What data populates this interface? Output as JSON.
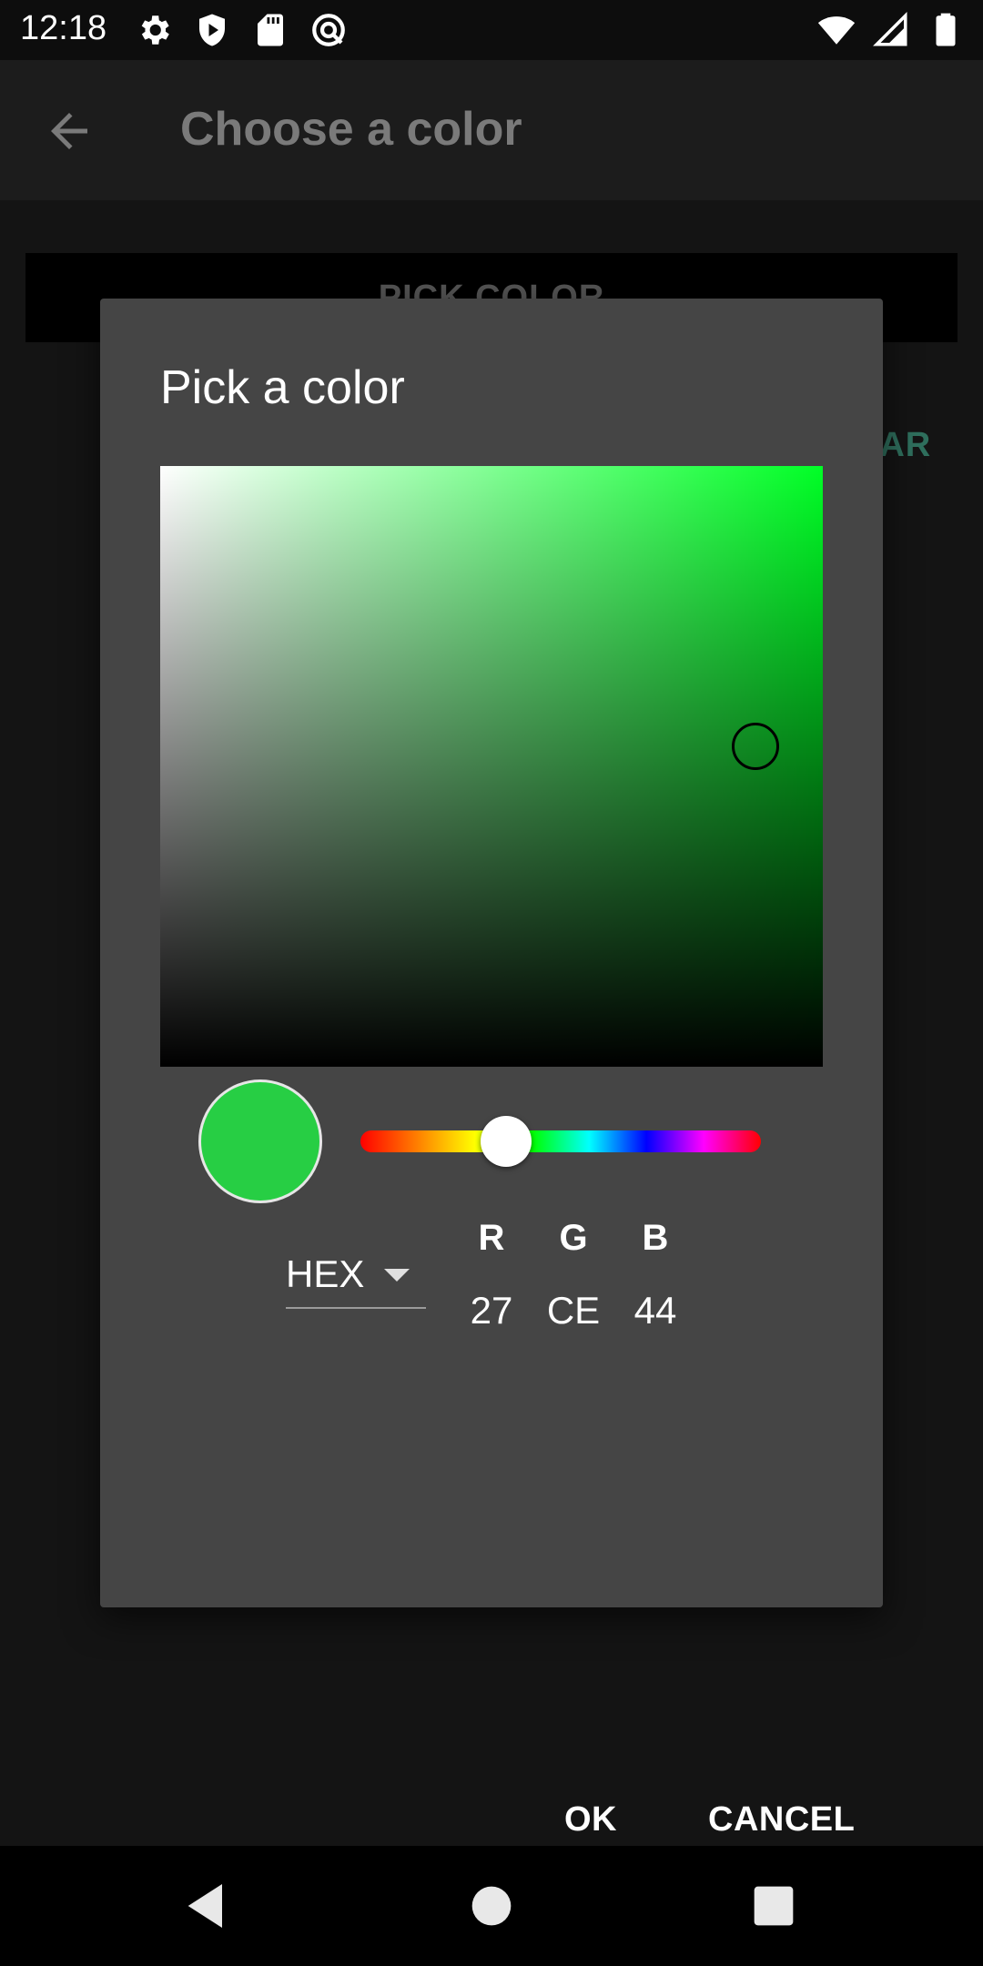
{
  "status_bar": {
    "time": "12:18",
    "left_icons": [
      "settings-icon",
      "shield-icon",
      "sd-card-icon",
      "do-not-disturb-icon"
    ],
    "right_icons": [
      "wifi-icon",
      "signal-icon",
      "battery-icon"
    ]
  },
  "app_bar": {
    "title": "Choose a color",
    "back_icon": "arrow-back-icon"
  },
  "background": {
    "pick_color_label": "PICK COLOR",
    "clear_label": "EAR"
  },
  "dialog": {
    "title": "Pick a color",
    "selected_color": "#27ce44",
    "mode": "HEX",
    "channels": [
      {
        "label": "R",
        "value": "27"
      },
      {
        "label": "G",
        "value": "CE"
      },
      {
        "label": "B",
        "value": "44"
      }
    ],
    "ok_label": "OK",
    "cancel_label": "CANCEL"
  },
  "nav_bar": {
    "icons": [
      "back-triangle-icon",
      "home-circle-icon",
      "recents-square-icon"
    ]
  }
}
